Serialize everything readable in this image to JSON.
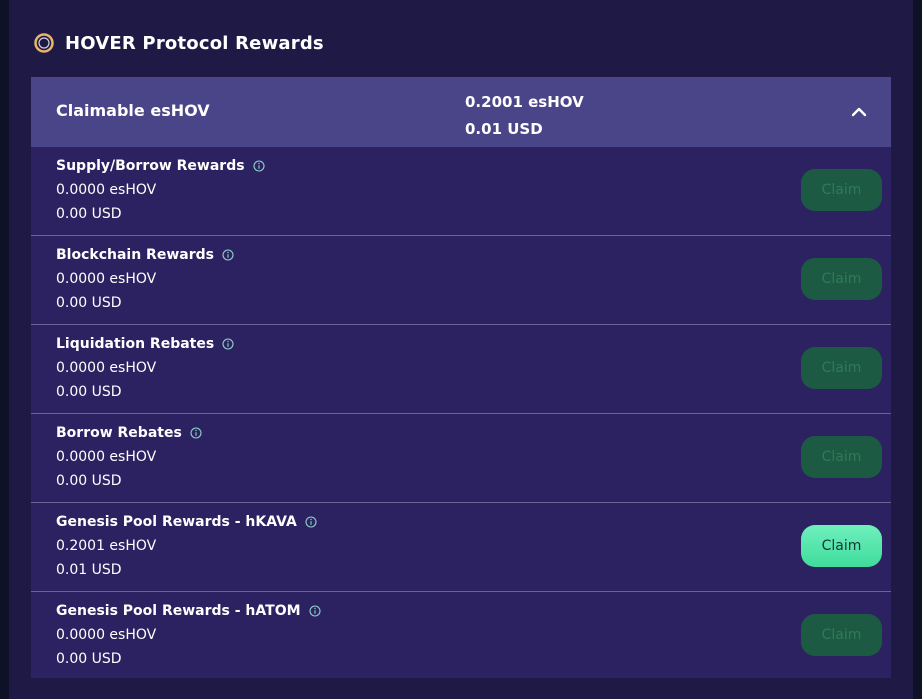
{
  "header": {
    "title": "HOVER Protocol Rewards",
    "logo_icon": "ring-logo-icon"
  },
  "summary": {
    "label": "Claimable esHOV",
    "amount": "0.2001 esHOV",
    "usd": "0.01 USD",
    "toggle_icon": "chevron-up-icon"
  },
  "rows": [
    {
      "title": "Supply/Borrow Rewards",
      "amount": "0.0000 esHOV",
      "usd": "0.00 USD",
      "claim_label": "Claim",
      "enabled": false
    },
    {
      "title": "Blockchain Rewards",
      "amount": "0.0000 esHOV",
      "usd": "0.00 USD",
      "claim_label": "Claim",
      "enabled": false
    },
    {
      "title": "Liquidation Rebates",
      "amount": "0.0000 esHOV",
      "usd": "0.00 USD",
      "claim_label": "Claim",
      "enabled": false
    },
    {
      "title": "Borrow Rebates",
      "amount": "0.0000 esHOV",
      "usd": "0.00 USD",
      "claim_label": "Claim",
      "enabled": false
    },
    {
      "title": "Genesis Pool Rewards - hKAVA",
      "amount": "0.2001 esHOV",
      "usd": "0.01 USD",
      "claim_label": "Claim",
      "enabled": true
    },
    {
      "title": "Genesis Pool Rewards - hATOM",
      "amount": "0.0000 esHOV",
      "usd": "0.00 USD",
      "claim_label": "Claim",
      "enabled": false
    }
  ],
  "colors": {
    "page_background": "#1f1a45",
    "card_background": "#2d2261",
    "summary_background": "#4a4488",
    "claim_enabled": "#4fe3a8",
    "claim_disabled": "#1d5a43",
    "info_icon": "#8fd3c8"
  }
}
